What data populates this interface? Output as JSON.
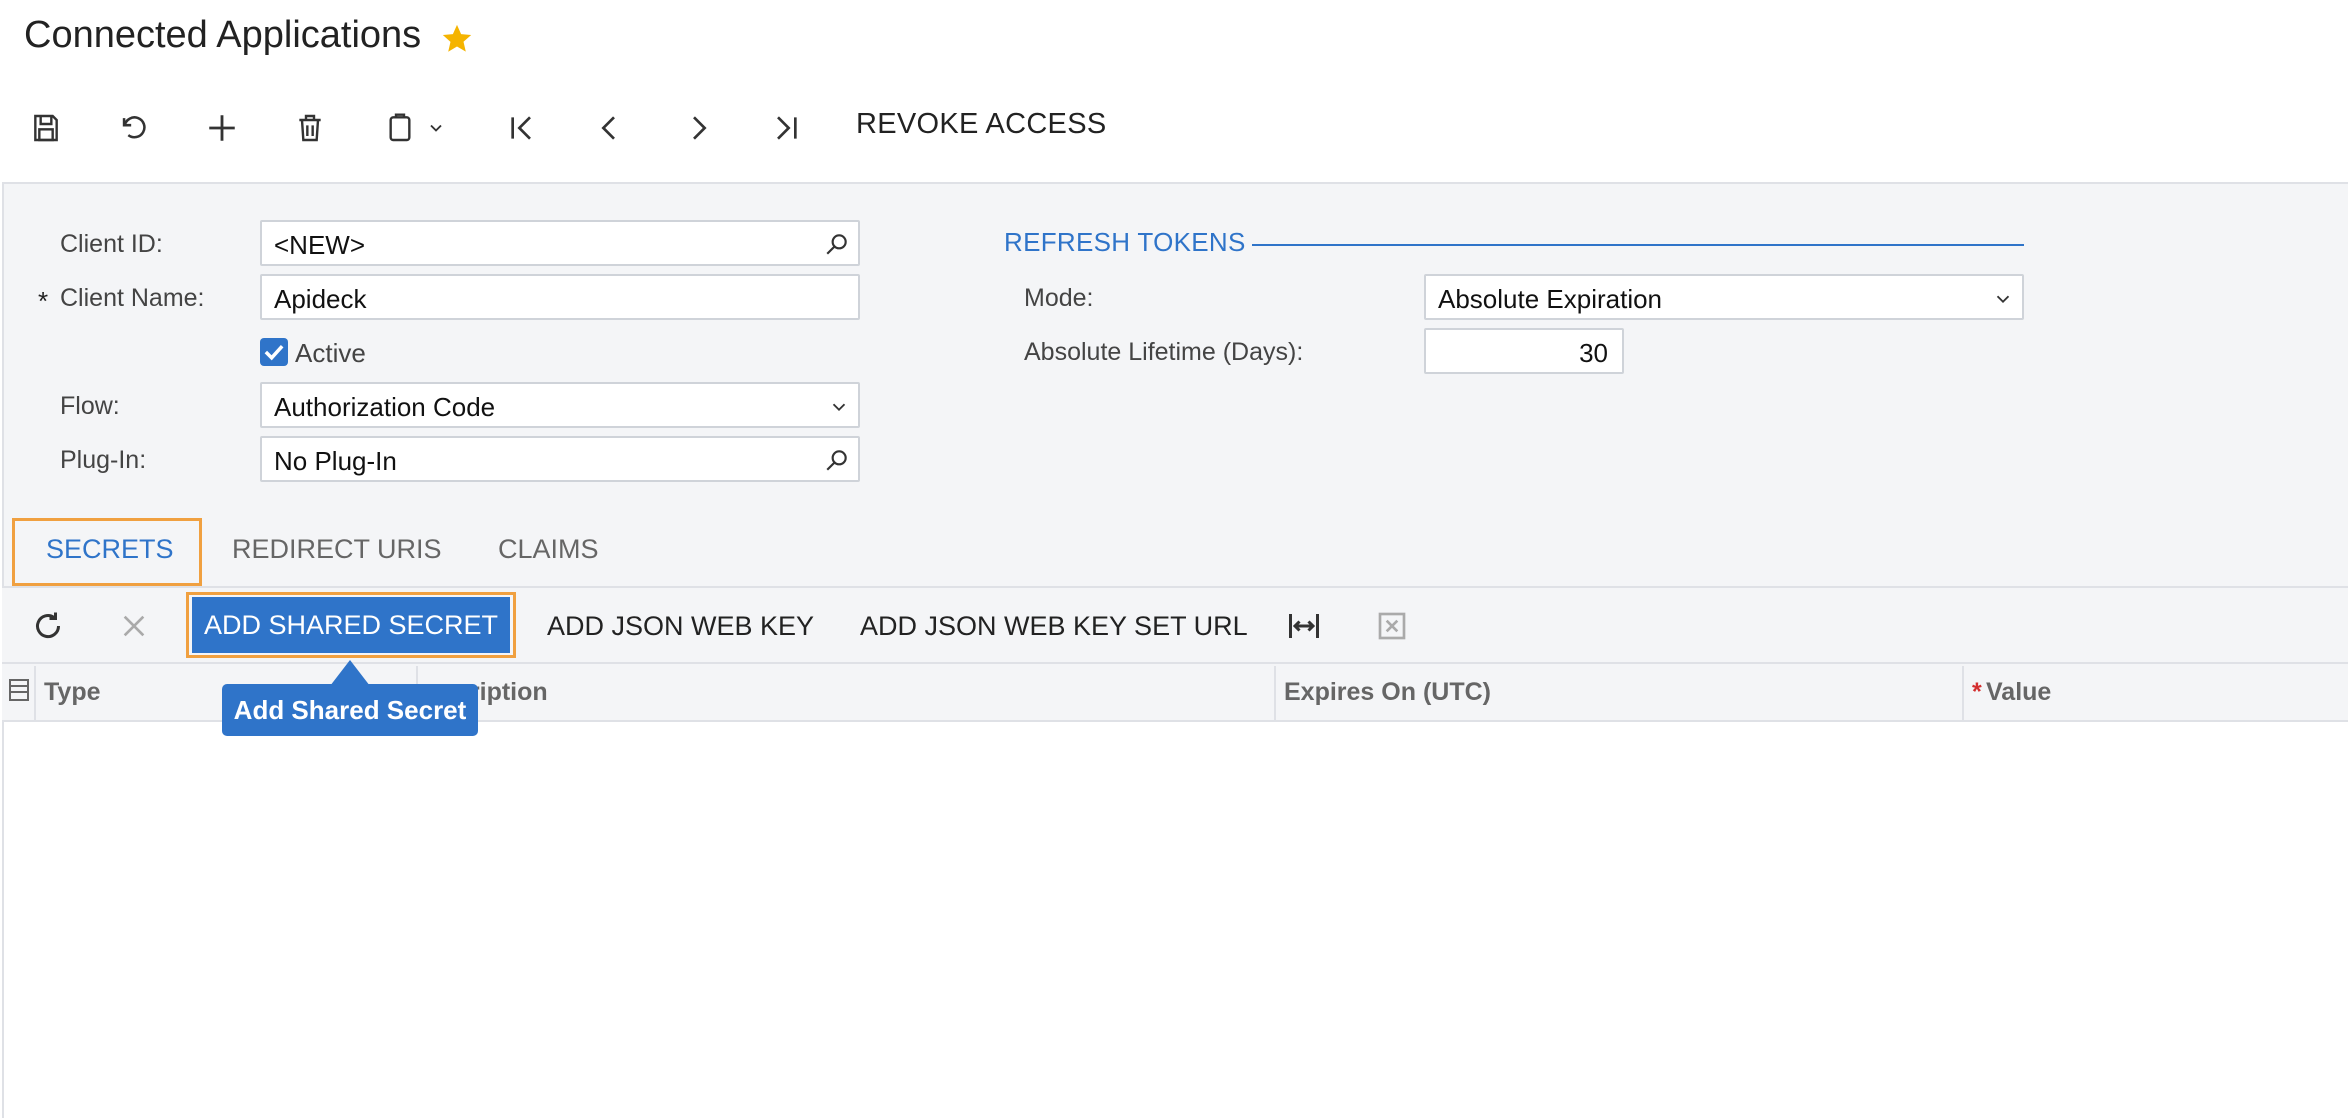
{
  "header": {
    "title": "Connected Applications",
    "favorite_icon": "star-icon"
  },
  "toolbar": {
    "icons": [
      "save-icon",
      "undo-icon",
      "add-icon",
      "delete-icon",
      "copy-paste-icon",
      "first-record-icon",
      "previous-record-icon",
      "next-record-icon",
      "last-record-icon"
    ],
    "revoke_label": "REVOKE ACCESS"
  },
  "form": {
    "client_id_label": "Client ID:",
    "client_id_value": "<NEW>",
    "client_name_label": "Client Name:",
    "client_name_value": "Apideck",
    "required_mark": "*",
    "active_label": "Active",
    "active_checked": true,
    "flow_label": "Flow:",
    "flow_value": "Authorization Code",
    "plugin_label": "Plug-In:",
    "plugin_value": "No Plug-In"
  },
  "refresh_tokens": {
    "section_title": "REFRESH TOKENS",
    "mode_label": "Mode:",
    "mode_value": "Absolute Expiration",
    "lifetime_label": "Absolute Lifetime (Days):",
    "lifetime_value": "30"
  },
  "tabs": [
    {
      "label": "SECRETS",
      "active": true
    },
    {
      "label": "REDIRECT URIS",
      "active": false
    },
    {
      "label": "CLAIMS",
      "active": false
    }
  ],
  "grid_toolbar": {
    "add_shared_secret": "ADD SHARED SECRET",
    "add_json_web_key": "ADD JSON WEB KEY",
    "add_json_web_key_set_url": "ADD JSON WEB KEY SET URL"
  },
  "tooltip": "Add Shared Secret",
  "grid": {
    "columns": [
      "Type",
      "Description",
      "Expires On (UTC)",
      "Value"
    ],
    "visible_description_fragment": "cription",
    "value_required_mark": "*"
  },
  "colors": {
    "accent": "#2f74c9",
    "highlight": "#f0a040",
    "star": "#f5b400",
    "required": "#d32f2f"
  }
}
